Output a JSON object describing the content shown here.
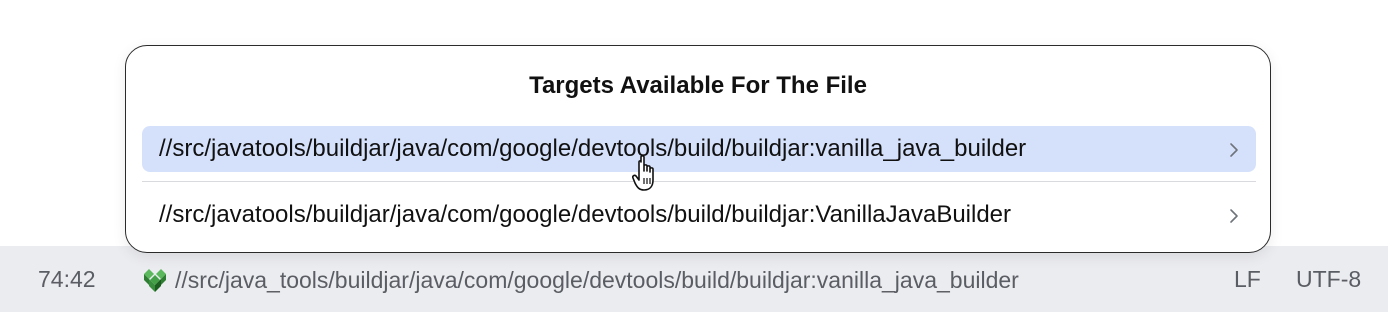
{
  "popup": {
    "title": "Targets Available For The File",
    "items": [
      {
        "label": "//src/javatools/buildjar/java/com/google/devtools/build/buildjar:vanilla_java_builder",
        "selected": true,
        "icon": "chevron-right-icon"
      },
      {
        "label": "//src/javatools/buildjar/java/com/google/devtools/build/buildjar:VanillaJavaBuilder",
        "selected": false,
        "icon": "chevron-right-icon"
      }
    ]
  },
  "status_bar": {
    "caret_position": "74:42",
    "target_icon": "bazel-icon",
    "target": "//src/java_tools/buildjar/java/com/google/devtools/build/buildjar:vanilla_java_builder",
    "line_separator": "LF",
    "encoding": "UTF-8"
  },
  "colors": {
    "selection": "#d5e1fb",
    "status_bar_bg": "#ebecf0",
    "bazel_green": "#43a047"
  },
  "cursor": "hand-pointer-icon"
}
